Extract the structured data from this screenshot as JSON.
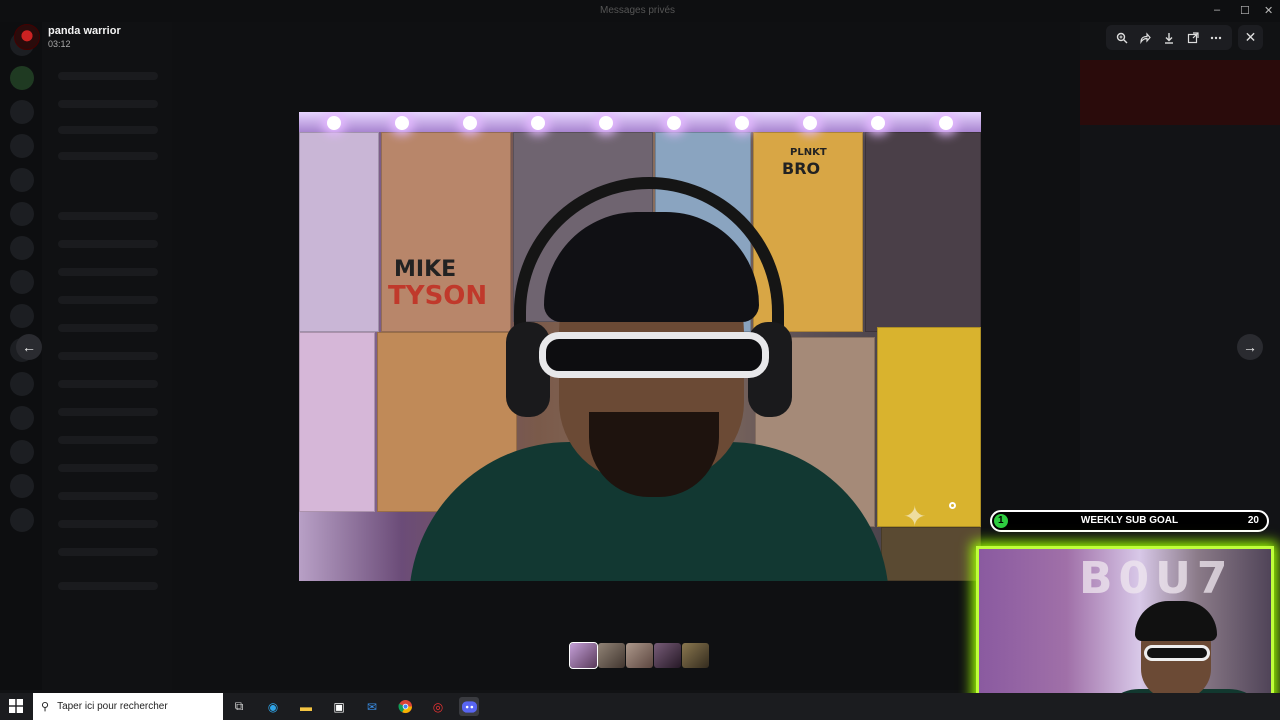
{
  "window": {
    "title": "Messages privés"
  },
  "viewer_header": {
    "username": "panda warrior",
    "timestamp": "03:12"
  },
  "subgoal": {
    "current": "1",
    "label": "WEEKLY SUB GOAL",
    "target": "20"
  },
  "webcam": {
    "overlay_text": "B0U7"
  },
  "mike_poster": {
    "line1": "MIKE",
    "line2": "TYSON"
  },
  "bro_poster": {
    "line1": "PLNKT",
    "line2": "BRO"
  },
  "search": {
    "placeholder": "Taper ici pour rechercher"
  },
  "toolbar": {
    "zoom": "zoom-icon",
    "forward": "forward-icon",
    "download": "download-icon",
    "open": "open-external-icon",
    "more": "more-icon"
  },
  "colors": {
    "accent": "#5865f2",
    "subgoal_green": "#2ecc40",
    "webcam_border": "#bfff3a"
  },
  "thumbnails": [
    {
      "name": "thumb-1",
      "active": true
    },
    {
      "name": "thumb-2",
      "active": false
    },
    {
      "name": "thumb-3",
      "active": false
    },
    {
      "name": "thumb-4",
      "active": false
    },
    {
      "name": "thumb-5",
      "active": false
    }
  ]
}
